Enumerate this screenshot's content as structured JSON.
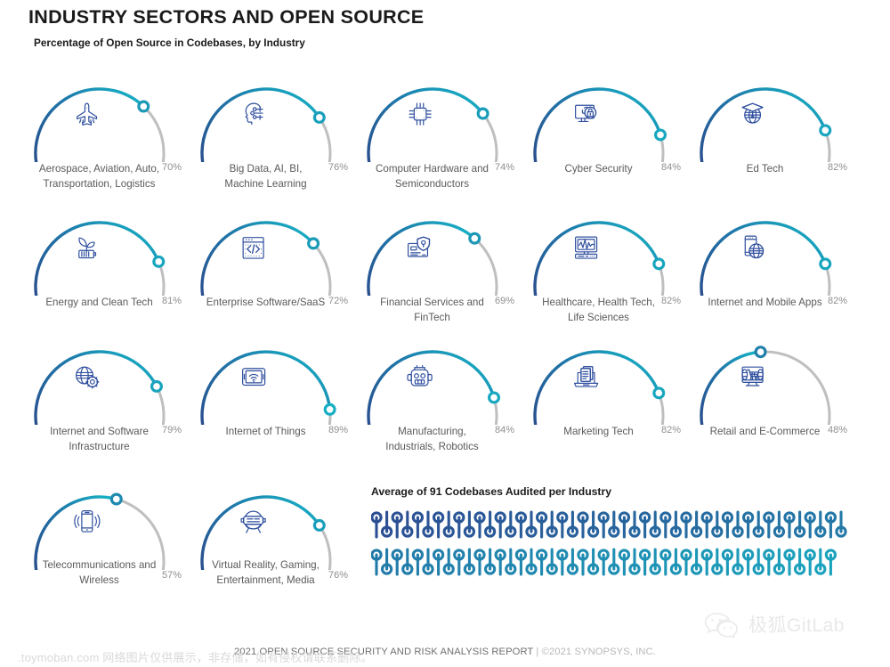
{
  "header": {
    "title": "INDUSTRY SECTORS AND OPEN SOURCE",
    "subtitle": "Percentage of Open Source in Codebases, by Industry"
  },
  "colors": {
    "arc_start": "#2b4a8b",
    "arc_end": "#16afc4",
    "arc_track": "#bfbfbf",
    "icon": "#2f4f9e",
    "label_text": "#5a5a5a",
    "pct_text": "#8f8f8f",
    "dots_start": "#2c4f93",
    "dots_end": "#1ba3bd"
  },
  "chart_data": {
    "type": "bar",
    "title": "Percentage of Open Source in Codebases, by Industry",
    "xlabel": "",
    "ylabel": "Percentage of Open Source in Codebases",
    "ylim": [
      0,
      100
    ],
    "unit": "%",
    "categories": [
      "Aerospace, Aviation, Auto, Transportation, Logistics",
      "Big Data, AI, BI, Machine Learning",
      "Computer Hardware and Semiconductors",
      "Cyber Security",
      "Ed Tech",
      "Energy and Clean Tech",
      "Enterprise Software/SaaS",
      "Financial Services and FinTech",
      "Healthcare, Health Tech, Life Sciences",
      "Internet and Mobile Apps",
      "Internet and Software Infrastructure",
      "Internet of Things",
      "Manufacturing, Industrials, Robotics",
      "Marketing Tech",
      "Retail and E-Commerce",
      "Telecommunications and Wireless",
      "Virtual Reality, Gaming, Entertainment, Media"
    ],
    "values": [
      70,
      76,
      74,
      84,
      82,
      81,
      72,
      69,
      82,
      82,
      79,
      89,
      84,
      82,
      48,
      57,
      76
    ]
  },
  "gauges": [
    [
      {
        "label": "Aerospace, Aviation, Auto,\nTransportation, Logistics",
        "value": 70,
        "pct": "70%",
        "icon": "airplane-icon"
      },
      {
        "label": "Big Data, AI, BI,\nMachine Learning",
        "value": 76,
        "pct": "76%",
        "icon": "ai-head-icon"
      },
      {
        "label": "Computer Hardware and\nSemiconductors",
        "value": 74,
        "pct": "74%",
        "icon": "cpu-chip-icon"
      },
      {
        "label": "Cyber Security",
        "value": 84,
        "pct": "84%",
        "icon": "monitor-lock-icon"
      },
      {
        "label": "Ed Tech",
        "value": 82,
        "pct": "82%",
        "icon": "globe-graduation-cap-icon"
      }
    ],
    [
      {
        "label": "Energy and Clean Tech",
        "value": 81,
        "pct": "81%",
        "icon": "battery-leaf-icon"
      },
      {
        "label": "Enterprise Software/SaaS",
        "value": 72,
        "pct": "72%",
        "icon": "code-window-icon"
      },
      {
        "label": "Financial Services and\nFinTech",
        "value": 69,
        "pct": "69%",
        "icon": "credit-card-shield-icon"
      },
      {
        "label": "Healthcare, Health Tech,\nLife Sciences",
        "value": 82,
        "pct": "82%",
        "icon": "vitals-monitor-icon"
      },
      {
        "label": "Internet and Mobile Apps",
        "value": 82,
        "pct": "82%",
        "icon": "phone-globe-icon"
      }
    ],
    [
      {
        "label": "Internet and Software\nInfrastructure",
        "value": 79,
        "pct": "79%",
        "icon": "globe-gear-icon"
      },
      {
        "label": "Internet of Things",
        "value": 89,
        "pct": "89%",
        "icon": "tablet-wifi-icon"
      },
      {
        "label": "Manufacturing,\nIndustrials, Robotics",
        "value": 84,
        "pct": "84%",
        "icon": "robot-head-icon"
      },
      {
        "label": "Marketing Tech",
        "value": 82,
        "pct": "82%",
        "icon": "laptop-documents-icon"
      },
      {
        "label": "Retail and E-Commerce",
        "value": 48,
        "pct": "48%",
        "icon": "monitor-cart-icon"
      }
    ],
    [
      {
        "label": "Telecommunications and\nWireless",
        "value": 57,
        "pct": "57%",
        "icon": "phone-signal-icon"
      },
      {
        "label": "Virtual Reality, Gaming,\nEntertainment, Media",
        "value": 76,
        "pct": "76%",
        "icon": "vr-headset-icon"
      }
    ]
  ],
  "codebases": {
    "title": "Average of 91 Codebases Audited per Industry",
    "count": 91,
    "per_row": 46
  },
  "footer": {
    "report": "2021 OPEN SOURCE SECURITY AND RISK ANALYSIS REPORT",
    "separator": " | ",
    "copyright": "©2021 SYNOPSYS, INC."
  },
  "watermark": {
    "text": ".toymoban.com 网络图片仅供展示，非存储，如有侵权请联系删除。",
    "brand": "极狐GitLab",
    "logo": "wechat-bubbles-icon"
  }
}
